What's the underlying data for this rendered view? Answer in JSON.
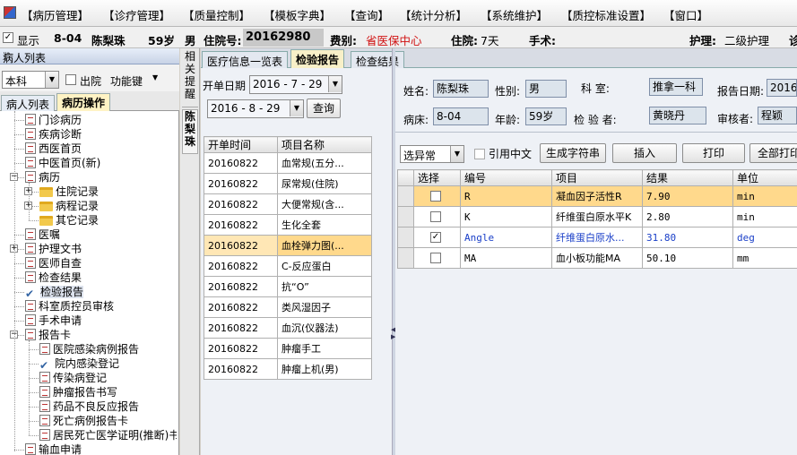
{
  "menu": {
    "app_icon": "app-logo-icon",
    "items": [
      "【病历管理】",
      "【诊疗管理】",
      "【质量控制】",
      "【模板字典】",
      "【查询】",
      "【统计分析】",
      "【系统维护】",
      "【质控标准设置】",
      "【窗口】"
    ]
  },
  "infobar": {
    "show_label": "显示",
    "bed": "8-04",
    "name": "陈梨珠",
    "age": "59岁",
    "sex": "男",
    "admission_no_label": "住院号:",
    "admission_no": "20162980",
    "payment_label": "费别:",
    "payment_value": "省医保中心",
    "stay_label": "住院:",
    "stay_value": "7天",
    "surgery_label": "手术:",
    "nursing_label": "护理:",
    "nursing_value": "二级护理",
    "trailing_text": "诊"
  },
  "left_panel": {
    "title": "病人列表",
    "pin_icon": "pin-icon",
    "dept_value": "本科",
    "discharge_label": "出院",
    "function_key_label": "功能键",
    "tabs": [
      "病人列表",
      "病历操作"
    ],
    "tree": [
      {
        "label": "门诊病历",
        "icon": "doc"
      },
      {
        "label": "疾病诊断",
        "icon": "doc"
      },
      {
        "label": "西医首页",
        "icon": "doc"
      },
      {
        "label": "中医首页(新)",
        "icon": "doc"
      },
      {
        "label": "病历",
        "icon": "doc"
      },
      {
        "label": "住院记录",
        "icon": "folder"
      },
      {
        "label": "病程记录",
        "icon": "folder"
      },
      {
        "label": "其它记录",
        "icon": "folder"
      },
      {
        "label": "医嘱",
        "icon": "doc"
      },
      {
        "label": "护理文书",
        "icon": "doc"
      },
      {
        "label": "医师自查",
        "icon": "doc"
      },
      {
        "label": "检查结果",
        "icon": "doc"
      },
      {
        "label": "检验报告",
        "icon": "check"
      },
      {
        "label": "科室质控员审核",
        "icon": "doc"
      },
      {
        "label": "手术申请",
        "icon": "doc"
      },
      {
        "label": "报告卡",
        "icon": "doc"
      },
      {
        "label": "医院感染病例报告",
        "icon": "doc"
      },
      {
        "label": "院内感染登记",
        "icon": "check"
      },
      {
        "label": "传染病登记",
        "icon": "doc"
      },
      {
        "label": "肿瘤报告书写",
        "icon": "doc"
      },
      {
        "label": "药品不良反应报告",
        "icon": "doc"
      },
      {
        "label": "死亡病例报告卡",
        "icon": "doc"
      },
      {
        "label": "居民死亡医学证明(推断)书",
        "icon": "doc"
      },
      {
        "label": "输血申请",
        "icon": "doc"
      }
    ]
  },
  "side_tabs": {
    "related": "相关提醒",
    "patient": "陈梨珠"
  },
  "tabs": [
    "医疗信息一览表",
    "检验报告",
    "检查结果"
  ],
  "filter": {
    "date_label": "开单日期",
    "date_from": "2016 - 7 - 29",
    "date_to": "2016 - 8 - 29",
    "query_button": "查询"
  },
  "orders_table": {
    "headers": [
      "开单时间",
      "项目名称"
    ],
    "rows": [
      [
        "20160822",
        "血常规(五分..."
      ],
      [
        "20160822",
        "尿常规(住院)"
      ],
      [
        "20160822",
        "大便常规(含..."
      ],
      [
        "20160822",
        "生化全套"
      ],
      [
        "20160822",
        "血栓弹力图(..."
      ],
      [
        "20160822",
        "C-反应蛋白"
      ],
      [
        "20160822",
        "抗“O”"
      ],
      [
        "20160822",
        "类风湿因子"
      ],
      [
        "20160822",
        "血沉(仪器法)"
      ],
      [
        "20160822",
        "肿瘤手工"
      ],
      [
        "20160822",
        "肿瘤上机(男)"
      ]
    ],
    "selected_index": 4
  },
  "report_header": {
    "name_label": "姓名:",
    "name": "陈梨珠",
    "sex_label": "性别:",
    "sex": "男",
    "dept_label": "科    室:",
    "dept": "推拿一科",
    "date_label": "报告日期:",
    "date": "20160",
    "bed_label": "病床:",
    "bed": "8-04",
    "age_label": "年龄:",
    "age": "59岁",
    "inspector_label": "检 验 者:",
    "inspector": "黄晓丹",
    "reviewer_label": "审核者:",
    "reviewer": "程颖"
  },
  "toolbar": {
    "filter_value": "选异常",
    "chinese_label": "引用中文",
    "gen_string_button": "生成字符串",
    "insert_button": "插入",
    "print_button": "打印",
    "print_all_button": "全部打印"
  },
  "results_table": {
    "headers": [
      "选择",
      "编号",
      "项目",
      "结果",
      "单位"
    ],
    "rows": [
      {
        "checked": false,
        "code": "R",
        "item": "凝血因子活性R",
        "result": "7.90",
        "unit": "min",
        "style": "sel"
      },
      {
        "checked": false,
        "code": "K",
        "item": "纤维蛋白原水平K",
        "result": "2.80",
        "unit": "min",
        "style": ""
      },
      {
        "checked": true,
        "code": "Angle",
        "item": "纤维蛋白原水...",
        "result": "31.80",
        "unit": "deg",
        "style": "blue"
      },
      {
        "checked": false,
        "code": "MA",
        "item": "血小板功能MA",
        "result": "50.10",
        "unit": "mm",
        "style": ""
      }
    ]
  }
}
